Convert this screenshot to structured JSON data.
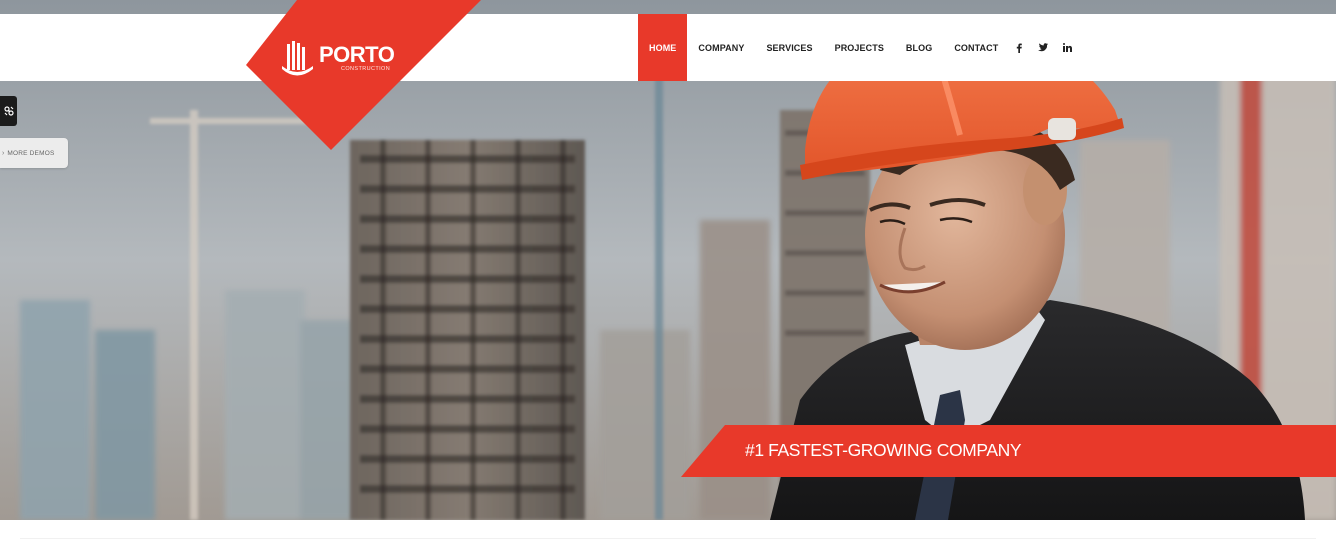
{
  "logo": {
    "name": "PORTO",
    "tagline": "CONSTRUCTION"
  },
  "nav": {
    "items": [
      {
        "label": "HOME",
        "active": true
      },
      {
        "label": "COMPANY",
        "active": false
      },
      {
        "label": "SERVICES",
        "active": false
      },
      {
        "label": "PROJECTS",
        "active": false
      },
      {
        "label": "BLOG",
        "active": false
      },
      {
        "label": "CONTACT",
        "active": false
      }
    ]
  },
  "socials": [
    {
      "icon": "facebook-icon"
    },
    {
      "icon": "twitter-icon"
    },
    {
      "icon": "linkedin-icon"
    }
  ],
  "sidebar": {
    "demo_toggle_icon": "gear-icon",
    "more_demos_label": "MORE DEMOS"
  },
  "hero": {
    "banner_text": "#1 FASTEST-GROWING COMPANY"
  },
  "colors": {
    "accent": "#e8392a",
    "text_dark": "#222222",
    "background": "#ffffff"
  }
}
